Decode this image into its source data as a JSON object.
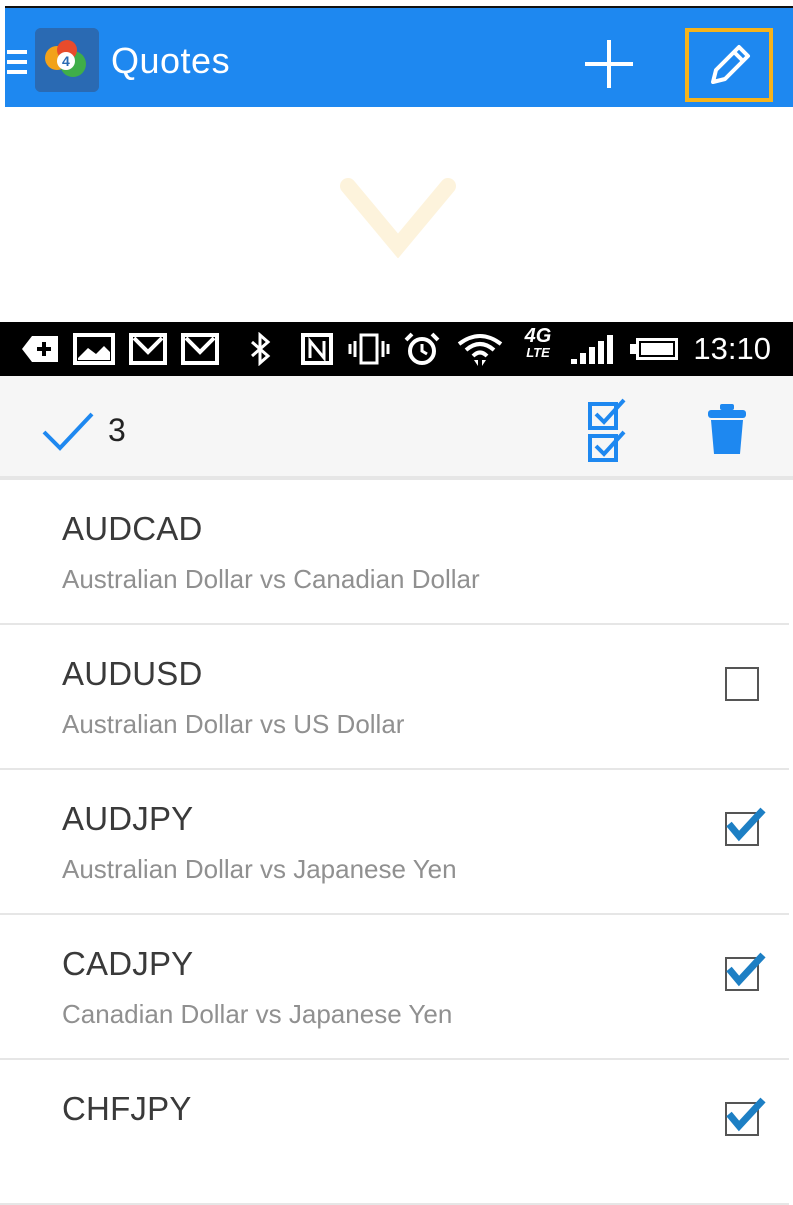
{
  "header": {
    "title": "Quotes",
    "accent_color": "#1e88f0",
    "highlight_color": "#f5b31b",
    "icons": [
      "menu-icon",
      "app-logo-icon",
      "plus-icon",
      "pencil-icon"
    ]
  },
  "hint": {
    "icon": "chevron-down-icon"
  },
  "status_bar": {
    "time": "13:10",
    "network": "4G",
    "network_sub": "LTE",
    "icons": [
      "add-icon",
      "image-icon",
      "gmail-icon",
      "gmail-icon",
      "bluetooth-icon",
      "nfc-icon",
      "vibrate-icon",
      "alarm-icon",
      "wifi-icon",
      "network-icon",
      "signal-icon",
      "battery-icon"
    ]
  },
  "action_bar": {
    "selected_count": "3",
    "icons": [
      "check-icon",
      "select-all-icon",
      "trash-icon"
    ]
  },
  "quotes": [
    {
      "symbol": "AUDCAD",
      "description": "Australian Dollar vs Canadian Dollar",
      "checkbox": "none"
    },
    {
      "symbol": "AUDUSD",
      "description": "Australian Dollar vs US Dollar",
      "checkbox": "unchecked"
    },
    {
      "symbol": "AUDJPY",
      "description": "Australian Dollar vs  Japanese Yen",
      "checkbox": "checked"
    },
    {
      "symbol": "CADJPY",
      "description": "Canadian Dollar vs Japanese Yen",
      "checkbox": "checked"
    },
    {
      "symbol": "CHFJPY",
      "description": "",
      "checkbox": "checked"
    }
  ]
}
